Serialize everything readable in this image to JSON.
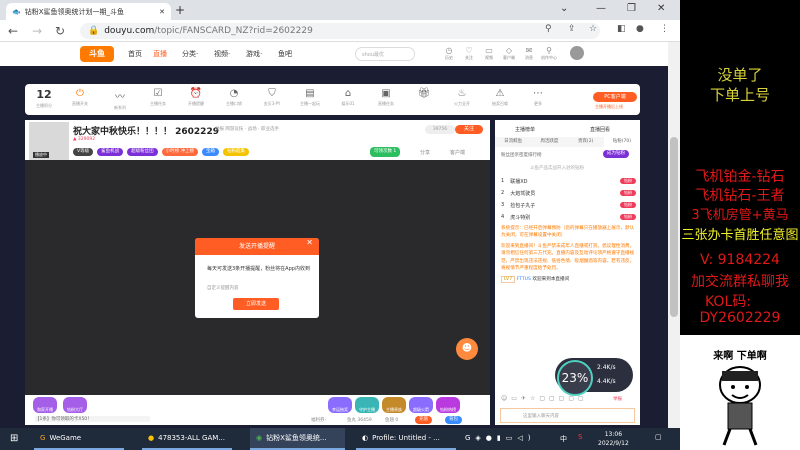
{
  "browser": {
    "tab_title": "钻粉X鲨鱼领奥统计划一期_斗鱼",
    "url_host": "douyu.com",
    "url_path": "/topic/FANSCARD_NZ?rid=2602229"
  },
  "site_header": {
    "logo": "斗鱼",
    "nav": [
      "首页",
      "直播",
      "分类·",
      "视频·",
      "游戏·",
      "鱼吧"
    ],
    "search_placeholder": "shou最优",
    "icons": [
      {
        "name": "history",
        "label": "历史"
      },
      {
        "name": "follow",
        "label": "关注"
      },
      {
        "name": "video",
        "label": "视频"
      },
      {
        "name": "client",
        "label": "客户端"
      },
      {
        "name": "message",
        "label": "消息"
      },
      {
        "name": "creator",
        "label": "创作中心"
      }
    ]
  },
  "anchor_toolbar": {
    "score": "12",
    "score_label": "主播积分",
    "items": [
      "直播开关",
      "新系列",
      "主播任务",
      "开播提醒",
      "主播口袋",
      "金贝3·PY",
      "主播一起玩",
      "娱乐01",
      "直播任务",
      "",
      "火力全开",
      "抽奖召唤",
      "更多"
    ],
    "pc_button": "PC客户端",
    "pc_sub": "主播开播后上线"
  },
  "stream": {
    "title": "祝大家中秋快乐！！！！ 2602229",
    "meta": "举报  网游竞技 · 战场 · 职业选手",
    "followers": "39756",
    "follow_btn": "关注",
    "hot": "329092",
    "badges": [
      "V等级",
      "鲨鱼机战",
      "超级粉丝团",
      "小时榜 冲上榜",
      "宝箱",
      "钻粉超集"
    ],
    "share": "分享",
    "report": "客户端",
    "claim": "可领次数 1",
    "avatar_label": "播放中"
  },
  "dialog": {
    "title": "发送开播提醒",
    "body": "每天可发送3条开播提醒，粉丝将在App内收到",
    "sub": "自定义提醒内容",
    "button": "立即发送"
  },
  "giftbar": {
    "left_gifts": [
      "和家开播",
      "钻粉大厅"
    ],
    "right_gifts": [
      "幸运抽奖",
      "守护主播",
      "主播贵族",
      "超级火箭",
      "钻粉热榜"
    ],
    "notice": "【1条】你可领取的卡X50！",
    "stats": [
      "福利券·",
      "鱼丸 36459",
      "鱼翅 0"
    ],
    "btn1": "充值",
    "btn2": "背包"
  },
  "chat": {
    "rank_tab1": "主播榜单",
    "rank_tab2": "直播回看",
    "tabs": [
      "日流鲸鱼",
      "周活跃度",
      "贵宾(2)",
      "钻粉(70)"
    ],
    "subtitle": "粉丝团亲密度排行榜",
    "join_btn": "成为钻粉",
    "hint": "斗鱼产品实战开入驻的钻粉",
    "ranks": [
      {
        "n": "1",
        "name": "联播XD",
        "tag": "钻粉"
      },
      {
        "n": "2",
        "name": "大炮驾驶员",
        "tag": "钻粉"
      },
      {
        "n": "3",
        "name": "捡包子丸子",
        "tag": "钻粉"
      },
      {
        "n": "4",
        "name": "虎斗特别",
        "tag": "钻粉"
      }
    ],
    "sys1": "系统提示：已经开启弹幕预防（您的弹幕只在播放器上展示，默认为关闭，可在弹幕设置中关闭）",
    "sys2": "欢迎来到直播间！斗鱼严禁未成年人直播或打赏。倡议理性消费，请勿相信任何第三方代充。直播内容及互动评论须严格遵守直播规范，严禁出现违法违规、低俗色情、吸烟酗酒等内容。若有违反，将视情节严重程度给予处罚。",
    "user_msg": "欢迎来到本直播间",
    "user": "FTTUS",
    "level": "LV7",
    "input_placeholder": "这里输入聊天内容",
    "speed_pct": "23%",
    "speed_up": "2.4K/s",
    "speed_down": "4.4K/s",
    "report": "举报"
  },
  "taskbar": {
    "apps": [
      "WeGame",
      "478353-ALL GAM...",
      "钻粉X鲨鱼领奥统...",
      "Profile: Untitled - ..."
    ],
    "ime": "中",
    "time": "13:06",
    "date": "2022/9/12"
  },
  "overlay": {
    "line1": "没单了",
    "line2": "下单上号",
    "red_lines": [
      "飞机铂金-钻石",
      "飞机钻石-王者",
      "3飞机房管+黄马"
    ],
    "yellow_line": "三张办卡首胜任意图",
    "v": "V:   9184224",
    "group": "加交流群私聊我",
    "kol": "KOL码:",
    "code": "DY2602229",
    "meme": "来啊 下单啊"
  }
}
